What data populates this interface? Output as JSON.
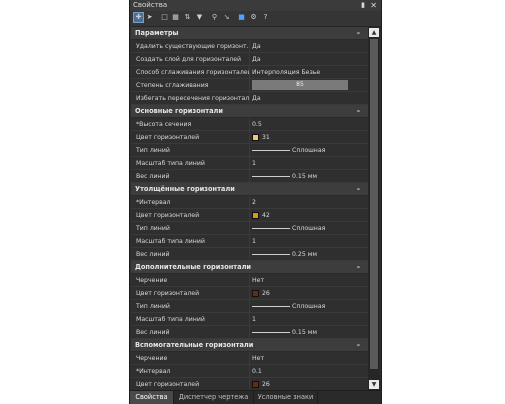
{
  "window": {
    "title": "Свойства",
    "pin_icon": "pin-icon",
    "close_glyph": "✕"
  },
  "toolbar": {
    "icons": [
      "select-icon",
      "pointer-icon",
      "select-window-icon",
      "grid-icon",
      "swap-icon",
      "filter-icon",
      "zoom-icon",
      "line-icon",
      "blue-tool-icon",
      "settings-icon",
      "help-icon"
    ]
  },
  "sections": [
    {
      "title": "Параметры",
      "collapse": "–",
      "rows": [
        {
          "label": "Удалить существующие горизонт...",
          "value": "Да"
        },
        {
          "label": "Создать слой для горизонталей",
          "value": "Да"
        },
        {
          "label": "Способ сглаживания горизонталей",
          "value": "Интерполяция Безье"
        },
        {
          "label": "Степень сглаживания",
          "value": "85",
          "type": "slider"
        },
        {
          "label": "Избегать пересечения горизонтал...",
          "value": "Да"
        }
      ]
    },
    {
      "title": "Основные горизонтали",
      "collapse": "–",
      "rows": [
        {
          "label": "*Высота сечения",
          "value": "0.5"
        },
        {
          "label": "Цвет горизонталей",
          "value": "31",
          "type": "color",
          "color": "#f2c27a"
        },
        {
          "label": "Тип линий",
          "value": "Сплошная",
          "type": "line"
        },
        {
          "label": "Масштаб типа линий",
          "value": "1"
        },
        {
          "label": "Вес линий",
          "value": "0.15 мм",
          "type": "line"
        }
      ]
    },
    {
      "title": "Утолщённые горизонтали",
      "collapse": "–",
      "rows": [
        {
          "label": "*Интервал",
          "value": "2"
        },
        {
          "label": "Цвет горизонталей",
          "value": "42",
          "type": "color",
          "color": "#d4a000"
        },
        {
          "label": "Тип линий",
          "value": "Сплошная",
          "type": "line"
        },
        {
          "label": "Масштаб типа линий",
          "value": "1"
        },
        {
          "label": "Вес линий",
          "value": "0.25 мм",
          "type": "line"
        }
      ]
    },
    {
      "title": "Дополнительные горизонтали",
      "collapse": "–",
      "rows": [
        {
          "label": "Черчение",
          "value": "Нет"
        },
        {
          "label": "Цвет горизонталей",
          "value": "26",
          "type": "color",
          "color": "#6b2a10"
        },
        {
          "label": "Тип линий",
          "value": "Сплошная",
          "type": "line"
        },
        {
          "label": "Масштаб типа линий",
          "value": "1"
        },
        {
          "label": "Вес линий",
          "value": "0.15 мм",
          "type": "line"
        }
      ]
    },
    {
      "title": "Вспомогательные горизонтали",
      "collapse": "–",
      "rows": [
        {
          "label": "Черчение",
          "value": "Нет"
        },
        {
          "label": "*Интервал",
          "value": "0.1"
        },
        {
          "label": "Цвет горизонталей",
          "value": "26",
          "type": "color",
          "color": "#6b2a10"
        }
      ]
    }
  ],
  "scrollbar": {
    "up": "▲",
    "down": "▼"
  },
  "tabs": [
    {
      "label": "Свойства",
      "active": true
    },
    {
      "label": "Диспетчер чертежа",
      "active": false
    },
    {
      "label": "Условные знаки",
      "active": false
    }
  ]
}
